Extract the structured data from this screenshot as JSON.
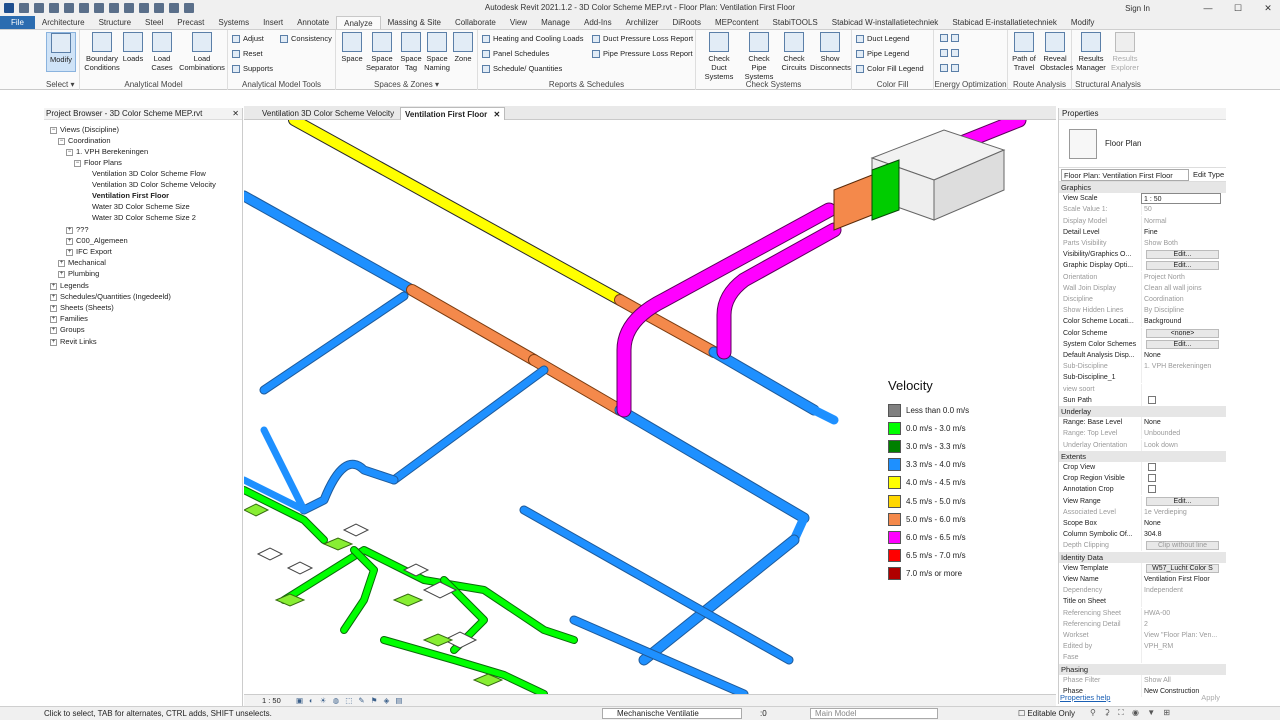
{
  "window": {
    "title": "Autodesk Revit 2021.1.2 - 3D Color Scheme MEP.rvt - Floor Plan: Ventilation First Floor",
    "sign_in": "Sign In"
  },
  "ribbon_tabs": [
    "File",
    "Architecture",
    "Structure",
    "Steel",
    "Precast",
    "Systems",
    "Insert",
    "Annotate",
    "Analyze",
    "Massing & Site",
    "Collaborate",
    "View",
    "Manage",
    "Add-Ins",
    "Archilizer",
    "DiRoots",
    "MEPcontent",
    "StabiTOOLS",
    "Stabicad W-installatietechniek",
    "Stabicad E-installatietechniek",
    "Modify"
  ],
  "active_tab": "Analyze",
  "ribbon": {
    "select": {
      "modify": "Modify",
      "title": "Select ▾"
    },
    "analytical_model": {
      "boundary_conditions": "Boundary Conditions",
      "loads": "Loads",
      "load_cases": "Load Cases",
      "load_combinations": "Load Combinations",
      "title": "Analytical Model"
    },
    "analytical_model_tools": {
      "adjust": "Adjust",
      "reset": "Reset",
      "supports": "Supports",
      "consistency": "Consistency",
      "title": "Analytical Model Tools"
    },
    "spaces_zones": {
      "space": "Space",
      "space_separator": "Space Separator",
      "space_tag": "Space Tag",
      "space_naming": "Space Naming",
      "zone": "Zone",
      "title": "Spaces & Zones ▾"
    },
    "reports": {
      "heating_cooling": "Heating and  Cooling Loads",
      "panel_schedules": "Panel  Schedules",
      "schedule_quantities": "Schedule/  Quantities",
      "duct_pressure": "Duct Pressure  Loss Report",
      "pipe_pressure": "Pipe Pressure  Loss Report",
      "title": "Reports & Schedules"
    },
    "check_systems": {
      "check_duct": "Check Duct Systems",
      "check_pipe": "Check Pipe Systems",
      "check_circuits": "Check Circuits",
      "show_disconnects": "Show Disconnects",
      "title": "Check Systems"
    },
    "color_fill": {
      "duct_legend": "Duct  Legend",
      "pipe_legend": "Pipe  Legend",
      "color_fill_legend": "Color Fill  Legend",
      "title": "Color Fill"
    },
    "energy": {
      "title": "Energy Optimization"
    },
    "route": {
      "path_of_travel": "Path of Travel",
      "reveal_obstacles": "Reveal Obstacles",
      "title": "Route Analysis"
    },
    "structural": {
      "results_manager": "Results Manager",
      "results_explorer": "Results Explorer",
      "title": "Structural Analysis"
    }
  },
  "project_browser": {
    "title": "Project Browser - 3D Color Scheme MEP.rvt",
    "items": [
      {
        "label": "Views (Discipline)",
        "exp": "−"
      },
      {
        "label": "Coordination",
        "exp": "−"
      },
      {
        "label": "1. VPH Berekeningen",
        "exp": "−"
      },
      {
        "label": "Floor Plans",
        "exp": "−"
      },
      {
        "label": "Ventilation 3D Color Scheme Flow",
        "exp": ""
      },
      {
        "label": "Ventilation 3D Color Scheme Velocity",
        "exp": ""
      },
      {
        "label": "Ventilation First Floor",
        "exp": ""
      },
      {
        "label": "Water 3D Color Scheme Size",
        "exp": ""
      },
      {
        "label": "Water 3D Color Scheme Size 2",
        "exp": ""
      },
      {
        "label": "???",
        "exp": "+"
      },
      {
        "label": "C00_Algemeen",
        "exp": "+"
      },
      {
        "label": "IFC Export",
        "exp": "+"
      },
      {
        "label": "Mechanical",
        "exp": "+"
      },
      {
        "label": "Plumbing",
        "exp": "+"
      },
      {
        "label": "Legends",
        "exp": "+"
      },
      {
        "label": "Schedules/Quantities (Ingedeeld)",
        "exp": "+"
      },
      {
        "label": "Sheets (Sheets)",
        "exp": "+"
      },
      {
        "label": "Families",
        "exp": "+"
      },
      {
        "label": "Groups",
        "exp": "+"
      },
      {
        "label": "Revit Links",
        "exp": "+"
      }
    ]
  },
  "view_tabs": [
    {
      "label": "Ventilation 3D Color Scheme Velocity"
    },
    {
      "label": "Ventilation First Floor"
    }
  ],
  "legend": {
    "title": "Velocity",
    "items": [
      {
        "label": "Less than 0.0 m/s",
        "color": "#808080"
      },
      {
        "label": "0.0 m/s - 3.0 m/s",
        "color": "#00ff00"
      },
      {
        "label": "3.0 m/s - 3.3 m/s",
        "color": "#008000"
      },
      {
        "label": "3.3 m/s - 4.0 m/s",
        "color": "#1e90ff"
      },
      {
        "label": "4.0 m/s - 4.5 m/s",
        "color": "#ffff00"
      },
      {
        "label": "4.5 m/s - 5.0 m/s",
        "color": "#ffd700"
      },
      {
        "label": "5.0 m/s - 6.0 m/s",
        "color": "#f4894b"
      },
      {
        "label": "6.0 m/s - 6.5 m/s",
        "color": "#ff00ff"
      },
      {
        "label": "6.5 m/s - 7.0 m/s",
        "color": "#ff0000"
      },
      {
        "label": "7.0 m/s or more",
        "color": "#b00000"
      }
    ]
  },
  "view_control": {
    "scale": "1 : 50"
  },
  "properties": {
    "title": "Properties",
    "type_name": "Floor Plan",
    "selector": "Floor Plan: Ventilation First Floor",
    "edit_type": "Edit Type",
    "rows": [
      {
        "g": "Graphics"
      },
      {
        "k": "View Scale",
        "v": "1 : 50",
        "box": true
      },
      {
        "k": "Scale Value    1:",
        "v": "50",
        "grey": true
      },
      {
        "k": "Display Model",
        "v": "Normal",
        "grey": true
      },
      {
        "k": "Detail Level",
        "v": "Fine"
      },
      {
        "k": "Parts Visibility",
        "v": "Show Both",
        "grey": true
      },
      {
        "k": "Visibility/Graphics O...",
        "v": "Edit...",
        "btn": true
      },
      {
        "k": "Graphic Display Opti...",
        "v": "Edit...",
        "btn": true
      },
      {
        "k": "Orientation",
        "v": "Project North",
        "grey": true
      },
      {
        "k": "Wall Join Display",
        "v": "Clean all wall joins",
        "grey": true
      },
      {
        "k": "Discipline",
        "v": "Coordination",
        "grey": true
      },
      {
        "k": "Show Hidden Lines",
        "v": "By Discipline",
        "grey": true
      },
      {
        "k": "Color Scheme Locati...",
        "v": "Background"
      },
      {
        "k": "Color Scheme",
        "v": "<none>",
        "btn": true
      },
      {
        "k": "System Color Schemes",
        "v": "Edit...",
        "btn": true
      },
      {
        "k": "Default Analysis Disp...",
        "v": "None"
      },
      {
        "k": "Sub-Discipline",
        "v": "1. VPH Berekeningen",
        "grey": true
      },
      {
        "k": "Sub-Discipline_1",
        "v": ""
      },
      {
        "k": "view soort",
        "v": "",
        "grey": true
      },
      {
        "k": "Sun Path",
        "v": "",
        "chk": true
      },
      {
        "g": "Underlay"
      },
      {
        "k": "Range: Base Level",
        "v": "None"
      },
      {
        "k": "Range: Top Level",
        "v": "Unbounded",
        "grey": true
      },
      {
        "k": "Underlay Orientation",
        "v": "Look down",
        "grey": true
      },
      {
        "g": "Extents"
      },
      {
        "k": "Crop View",
        "v": "",
        "chk": true
      },
      {
        "k": "Crop Region Visible",
        "v": "",
        "chk": true
      },
      {
        "k": "Annotation Crop",
        "v": "",
        "chk": true
      },
      {
        "k": "View Range",
        "v": "Edit...",
        "btn": true
      },
      {
        "k": "Associated Level",
        "v": "1e Verdieping",
        "grey": true
      },
      {
        "k": "Scope Box",
        "v": "None"
      },
      {
        "k": "Column Symbolic Of...",
        "v": "304.8"
      },
      {
        "k": "Depth Clipping",
        "v": "Clip without line",
        "btn": true,
        "grey": true
      },
      {
        "g": "Identity Data"
      },
      {
        "k": "View Template",
        "v": "W57_Lucht Color S",
        "btn": true
      },
      {
        "k": "View Name",
        "v": "Ventilation First Floor"
      },
      {
        "k": "Dependency",
        "v": "Independent",
        "grey": true
      },
      {
        "k": "Title on Sheet",
        "v": ""
      },
      {
        "k": "Referencing Sheet",
        "v": "HWA-00",
        "grey": true
      },
      {
        "k": "Referencing Detail",
        "v": "2",
        "grey": true
      },
      {
        "k": "Workset",
        "v": "View \"Floor Plan: Ven...",
        "grey": true
      },
      {
        "k": "Edited by",
        "v": "VPH_RM",
        "grey": true
      },
      {
        "k": "Fase",
        "v": "",
        "grey": true
      },
      {
        "g": "Phasing"
      },
      {
        "k": "Phase Filter",
        "v": "Show All",
        "grey": true
      },
      {
        "k": "Phase",
        "v": "New Construction"
      }
    ],
    "help": "Properties help",
    "apply": "Apply"
  },
  "status": {
    "hint": "Click to select, TAB for alternates, CTRL adds, SHIFT unselects.",
    "workset": "Mechanische Ventilatie",
    "coord": ":0",
    "model": "Main Model",
    "editable": "Editable Only"
  },
  "colors": {
    "ribbon_active": "#2b6cb0",
    "duct_blue": "#1e90ff",
    "duct_yellow": "#ffff00",
    "duct_orange": "#f4894b",
    "duct_magenta": "#ff00ff",
    "duct_green": "#00ff00"
  }
}
